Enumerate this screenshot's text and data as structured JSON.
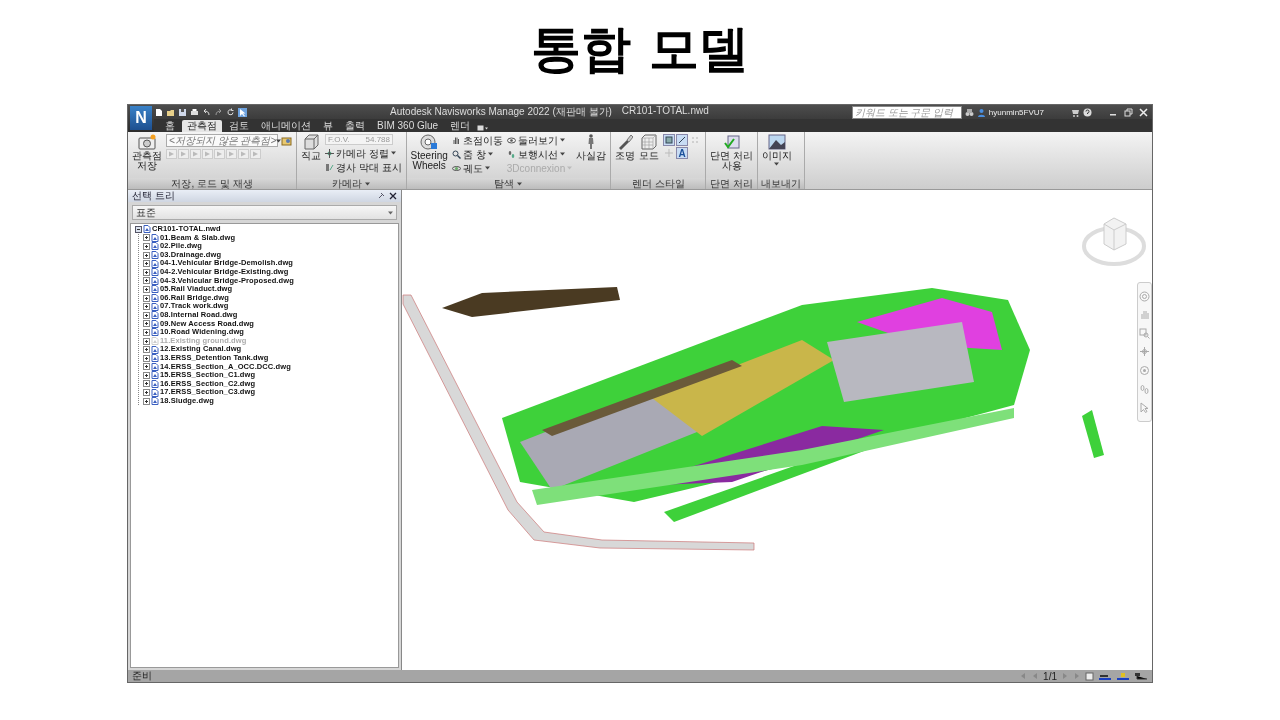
{
  "slide": {
    "title": "통합 모델"
  },
  "window": {
    "logo": "N",
    "title": "Autodesk Navisworks Manage 2022 (재판매 불가)",
    "file": "CR101-TOTAL.nwd"
  },
  "search": {
    "placeholder": "키워드 또는 구문 입력"
  },
  "user": "hyunmin5FVU7",
  "tabs": [
    {
      "label": "홈",
      "selected": false
    },
    {
      "label": "관측점",
      "selected": true
    },
    {
      "label": "검토",
      "selected": false
    },
    {
      "label": "애니메이션",
      "selected": false
    },
    {
      "label": "뷰",
      "selected": false
    },
    {
      "label": "출력",
      "selected": false
    },
    {
      "label": "BIM 360 Glue",
      "selected": false
    },
    {
      "label": "렌더",
      "selected": false
    }
  ],
  "ribbon": {
    "viewpoint": {
      "title": "저장, 로드 및 재생",
      "save": "관측점\n저장",
      "select_value": "<저장되지 않은 관측점>"
    },
    "camera": {
      "title": "카메라",
      "ortho": "직교",
      "fov_label": "F.O.V.",
      "fov_value": "54.788",
      "align": "카메라 정렬",
      "tilt": "경사 막대 표시"
    },
    "navigate": {
      "title": "탐색",
      "wheels": "Steering\nWheels",
      "pan": "초점이동",
      "zoom": "줌 창",
      "orbit": "궤도",
      "look": "둘러보기",
      "walk": "보행시선",
      "connexion": {
        "label": "3Dconnexion",
        "disabled": true
      },
      "realism": "사실감"
    },
    "render": {
      "title": "렌더 스타일",
      "lighting": "조명",
      "mode": "모드",
      "text_toggle": "A"
    },
    "sectioning": {
      "title": "단면 처리",
      "enable": "단면 처리\n사용"
    },
    "export": {
      "title": "내보내기",
      "image": "이미지"
    }
  },
  "tree_panel": {
    "title": "선택 트리",
    "dropdown": "표준",
    "root": {
      "label": "CR101-TOTAL.nwd",
      "expanded": true,
      "children": [
        {
          "label": "01.Beam & Slab.dwg",
          "expanded": false,
          "hidden": false
        },
        {
          "label": "02.Pile.dwg",
          "expanded": false,
          "hidden": false
        },
        {
          "label": "03.Drainage.dwg",
          "expanded": false,
          "hidden": false
        },
        {
          "label": "04-1.Vehicular Bridge-Demolish.dwg",
          "expanded": false,
          "hidden": false
        },
        {
          "label": "04-2.Vehicular Bridge-Existing.dwg",
          "expanded": false,
          "hidden": false
        },
        {
          "label": "04-3.Vehicular Bridge-Proposed.dwg",
          "expanded": false,
          "hidden": false
        },
        {
          "label": "05.Rail Viaduct.dwg",
          "expanded": false,
          "hidden": false
        },
        {
          "label": "06.Rail Bridge.dwg",
          "expanded": false,
          "hidden": false
        },
        {
          "label": "07.Track work.dwg",
          "expanded": false,
          "hidden": false
        },
        {
          "label": "08.Internal Road.dwg",
          "expanded": false,
          "hidden": false
        },
        {
          "label": "09.New Access Road.dwg",
          "expanded": false,
          "hidden": false
        },
        {
          "label": "10.Road Widening.dwg",
          "expanded": false,
          "hidden": false
        },
        {
          "label": "11.Existing ground.dwg",
          "expanded": false,
          "hidden": true
        },
        {
          "label": "12.Existing Canal.dwg",
          "expanded": false,
          "hidden": false
        },
        {
          "label": "13.ERSS_Detention Tank.dwg",
          "expanded": false,
          "hidden": false
        },
        {
          "label": "14.ERSS_Section_A_OCC.DCC.dwg",
          "expanded": false,
          "hidden": false
        },
        {
          "label": "15.ERSS_Section_C1.dwg",
          "expanded": false,
          "hidden": false
        },
        {
          "label": "16.ERSS_Section_C2.dwg",
          "expanded": false,
          "hidden": false
        },
        {
          "label": "17.ERSS_Section_C3.dwg",
          "expanded": false,
          "hidden": false
        },
        {
          "label": "18.Sludge.dwg",
          "expanded": false,
          "hidden": false
        }
      ]
    }
  },
  "status": {
    "text": "준비",
    "page": "1/1"
  }
}
